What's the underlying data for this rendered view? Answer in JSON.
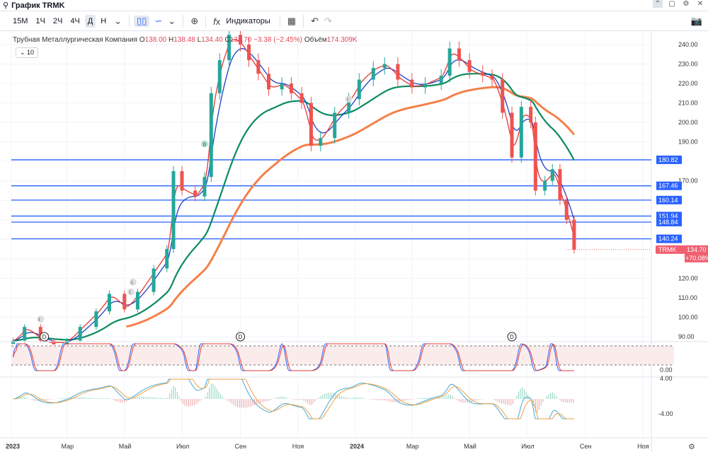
{
  "topbar": {
    "title": "График TRMK",
    "icons": [
      "search-icon",
      "chevron-up-icon",
      "window-icon",
      "gear-icon",
      "close-icon"
    ]
  },
  "toolbar": {
    "intervals": [
      "15M",
      "1Ч",
      "2Ч",
      "4Ч",
      "Д",
      "Н"
    ],
    "active_interval": "Д",
    "indicators_label": "Индикаторы"
  },
  "legend": {
    "name": "Трубная Металлургическая Компания",
    "o_label": "O",
    "o": "138.00",
    "h_label": "H",
    "h": "138.48",
    "l_label": "L",
    "l": "134.40",
    "c_label": "C",
    "c": "134.70",
    "change": "−3.38 (−2.45%)",
    "vol_label": "Объём",
    "vol": "174.309K",
    "collapse": "10"
  },
  "colors": {
    "up": "#26a69a",
    "down": "#ef5350",
    "level": "#2962ff",
    "ma_fast": "#e53935",
    "ma_mid": "#1e40c8",
    "ma_slow": "#0a8a5f",
    "ma_long": "#f4804a",
    "price_tag": "#f06070"
  },
  "chart_data": {
    "type": "candlestick",
    "ticker": "TRMK",
    "last_price": "134.70",
    "last_change": "+70.08%",
    "ylim": [
      85,
      245
    ],
    "y_ticks": [
      "240.00",
      "230.00",
      "220.00",
      "210.00",
      "200.00",
      "190.00",
      "170.00",
      "120.00",
      "110.00",
      "100.00",
      "90.00"
    ],
    "x_ticks": [
      {
        "label": "2023",
        "date": "2023-01-01"
      },
      {
        "label": "Мар",
        "date": "2023-03-01"
      },
      {
        "label": "Май",
        "date": "2023-05-01"
      },
      {
        "label": "Июл",
        "date": "2023-07-01"
      },
      {
        "label": "Сен",
        "date": "2023-09-01"
      },
      {
        "label": "Ноя",
        "date": "2023-11-01"
      },
      {
        "label": "2024",
        "date": "2024-01-01"
      },
      {
        "label": "Мар",
        "date": "2024-03-01"
      },
      {
        "label": "Май",
        "date": "2024-05-01"
      },
      {
        "label": "Июл",
        "date": "2024-07-01"
      },
      {
        "label": "Сен",
        "date": "2024-09-01"
      },
      {
        "label": "Ноя",
        "date": "2024-11-01"
      }
    ],
    "levels": [
      "180.82",
      "167.46",
      "160.14",
      "151.94",
      "148.84",
      "140.24"
    ],
    "closes": [
      [
        "2023-01-03",
        88
      ],
      [
        "2023-01-15",
        95
      ],
      [
        "2023-02-01",
        88
      ],
      [
        "2023-02-15",
        86
      ],
      [
        "2023-03-01",
        88
      ],
      [
        "2023-03-15",
        95
      ],
      [
        "2023-04-01",
        103
      ],
      [
        "2023-04-15",
        112
      ],
      [
        "2023-05-01",
        104
      ],
      [
        "2023-05-15",
        113
      ],
      [
        "2023-06-01",
        125
      ],
      [
        "2023-06-15",
        135
      ],
      [
        "2023-06-22",
        175
      ],
      [
        "2023-07-01",
        165
      ],
      [
        "2023-07-15",
        162
      ],
      [
        "2023-07-25",
        172
      ],
      [
        "2023-08-01",
        215
      ],
      [
        "2023-08-10",
        232
      ],
      [
        "2023-08-20",
        245
      ],
      [
        "2023-09-01",
        240
      ],
      [
        "2023-09-10",
        232
      ],
      [
        "2023-09-20",
        225
      ],
      [
        "2023-10-01",
        217
      ],
      [
        "2023-10-15",
        220
      ],
      [
        "2023-10-25",
        215
      ],
      [
        "2023-11-05",
        210
      ],
      [
        "2023-11-15",
        188
      ],
      [
        "2023-11-25",
        192
      ],
      [
        "2023-12-10",
        205
      ],
      [
        "2023-12-25",
        212
      ],
      [
        "2024-01-05",
        222
      ],
      [
        "2024-01-20",
        228
      ],
      [
        "2024-02-01",
        230
      ],
      [
        "2024-02-15",
        222
      ],
      [
        "2024-03-01",
        218
      ],
      [
        "2024-03-15",
        220
      ],
      [
        "2024-04-01",
        224
      ],
      [
        "2024-04-10",
        238
      ],
      [
        "2024-04-20",
        232
      ],
      [
        "2024-05-01",
        226
      ],
      [
        "2024-05-15",
        224
      ],
      [
        "2024-05-25",
        222
      ],
      [
        "2024-06-05",
        205
      ],
      [
        "2024-06-15",
        182
      ],
      [
        "2024-06-25",
        208
      ],
      [
        "2024-07-05",
        200
      ],
      [
        "2024-07-10",
        165
      ],
      [
        "2024-07-20",
        170
      ],
      [
        "2024-07-28",
        176
      ],
      [
        "2024-08-05",
        160
      ],
      [
        "2024-08-12",
        150
      ],
      [
        "2024-08-20",
        134.7
      ]
    ],
    "markers": [
      {
        "label": "D",
        "date": "2023-02-05"
      },
      {
        "label": "D",
        "date": "2023-09-01"
      },
      {
        "label": "D",
        "date": "2024-06-15"
      }
    ],
    "events": [
      {
        "label": "I",
        "date": "2023-02-01",
        "price": 99
      },
      {
        "label": "I",
        "date": "2023-05-10",
        "price": 118
      },
      {
        "label": "I",
        "date": "2023-05-08",
        "price": 113
      },
      {
        "label": "B",
        "date": "2023-07-25",
        "price": 189
      },
      {
        "label": "I",
        "date": "2023-12-25",
        "price": 212
      }
    ],
    "panes": [
      {
        "name": "stochastic",
        "ticks": [
          "0.00"
        ]
      },
      {
        "name": "macd",
        "ticks": [
          "4.00",
          "-4.00"
        ]
      }
    ]
  }
}
